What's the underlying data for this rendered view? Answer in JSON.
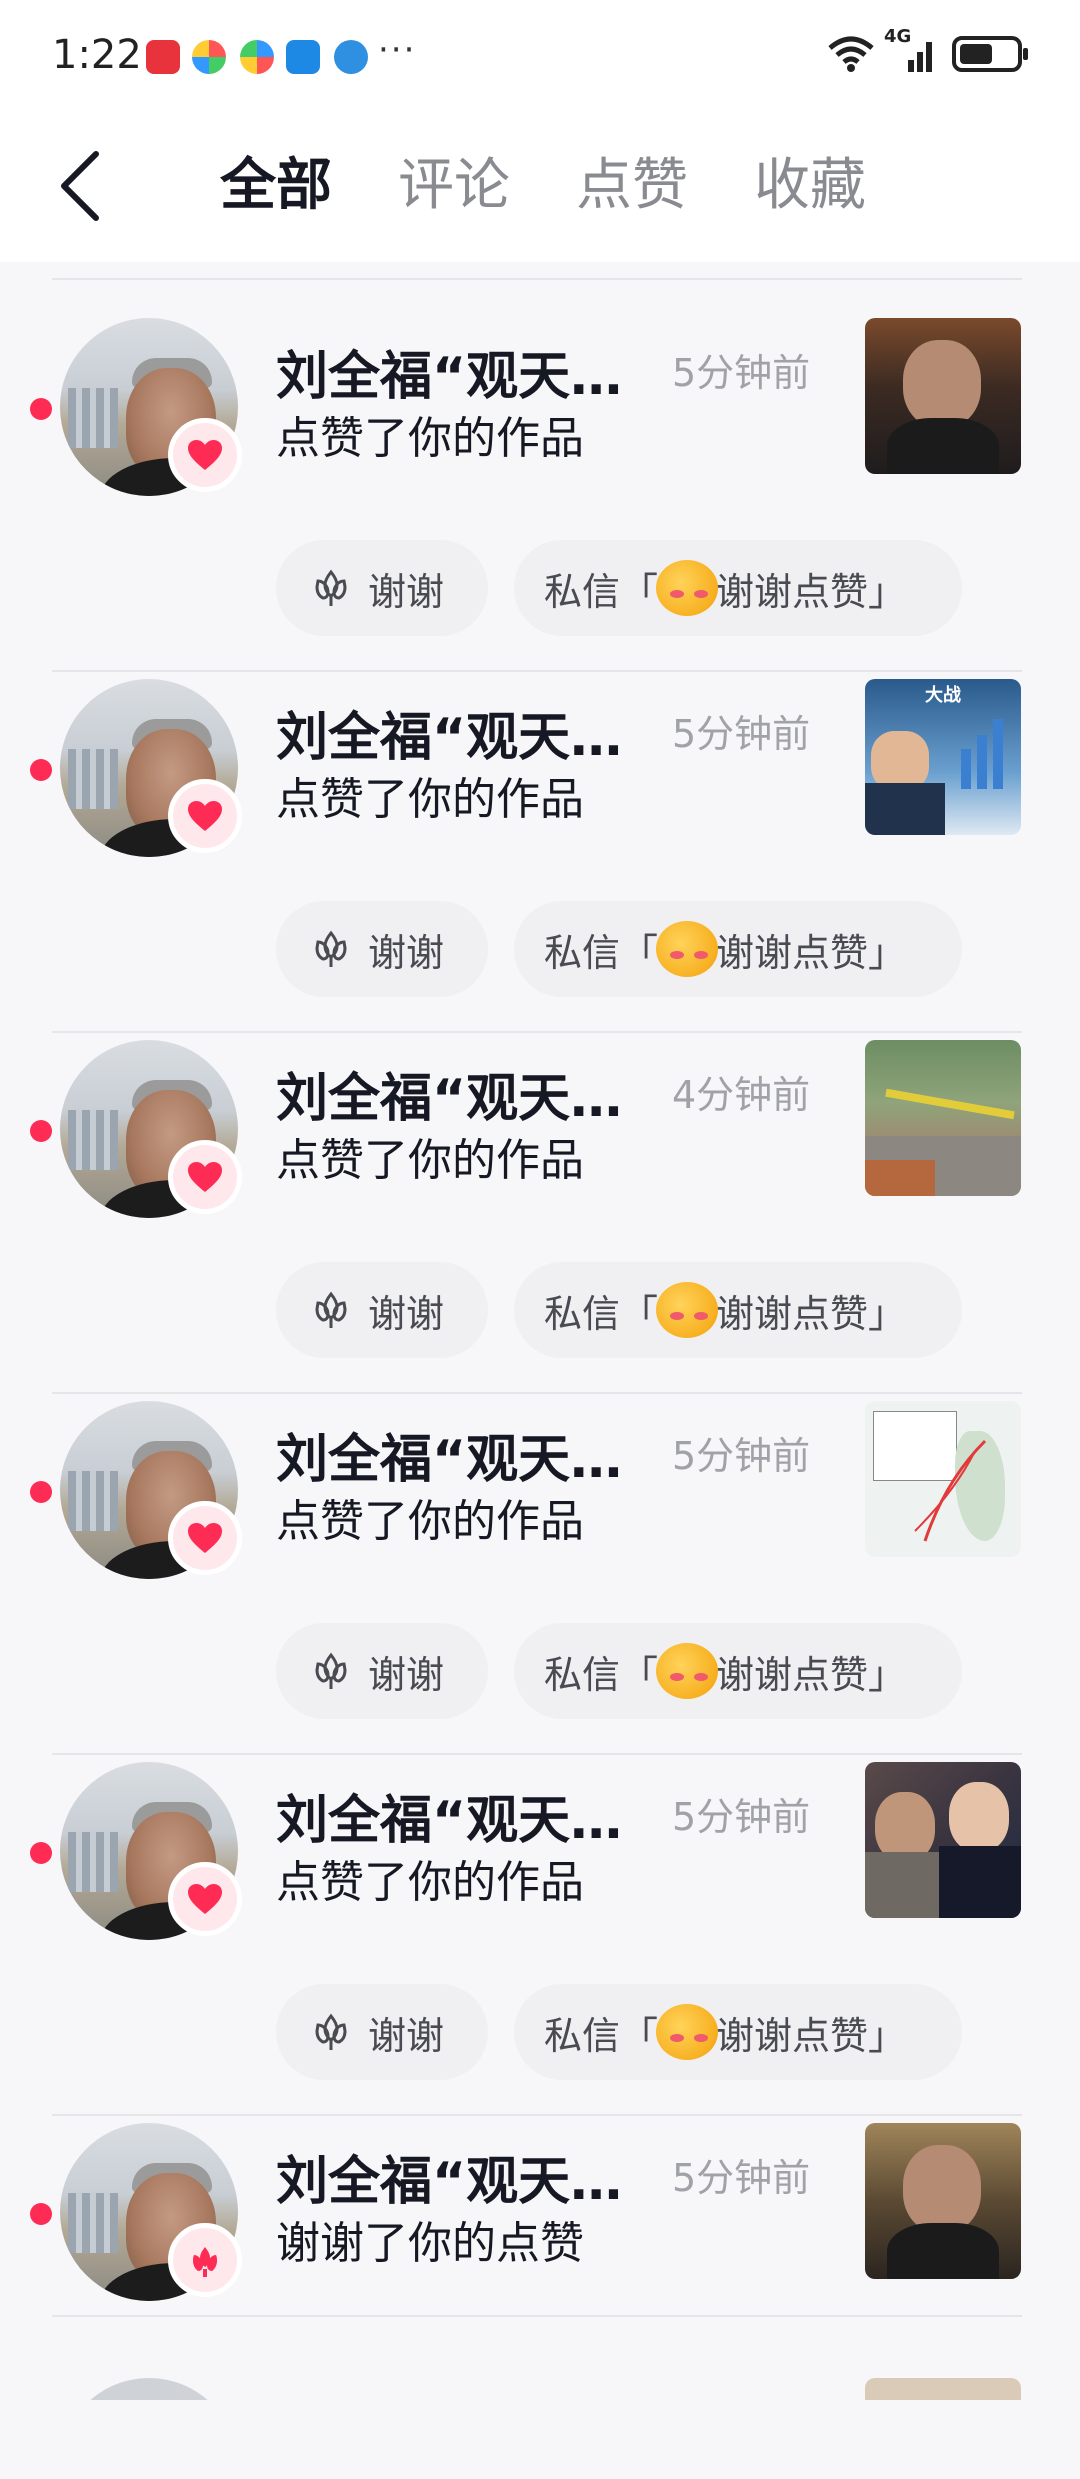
{
  "status_bar": {
    "time": "1:22",
    "more": "···",
    "network": "4G"
  },
  "header": {
    "tabs": [
      {
        "label": "全部",
        "active": true
      },
      {
        "label": "评论",
        "active": false
      },
      {
        "label": "点赞",
        "active": false
      },
      {
        "label": "收藏",
        "active": false
      }
    ]
  },
  "colors": {
    "accent": "#fe2c55",
    "text_primary": "#161823",
    "text_secondary": "#a1a2a8",
    "button_bg": "#f0f0f2"
  },
  "notifications": [
    {
      "name": "刘全福“观天…",
      "time": "5分钟前",
      "action": "点赞了你的作品",
      "badge_icon": "heart-icon",
      "thumb_caption": "",
      "thanks_label": "谢谢",
      "dm_prefix": "私信「",
      "dm_suffix": "谢谢点赞」"
    },
    {
      "name": "刘全福“观天…",
      "time": "5分钟前",
      "action": "点赞了你的作品",
      "badge_icon": "heart-icon",
      "thumb_caption": "大战",
      "thanks_label": "谢谢",
      "dm_prefix": "私信「",
      "dm_suffix": "谢谢点赞」"
    },
    {
      "name": "刘全福“观天…",
      "time": "4分钟前",
      "action": "点赞了你的作品",
      "badge_icon": "heart-icon",
      "thumb_caption": "",
      "thanks_label": "谢谢",
      "dm_prefix": "私信「",
      "dm_suffix": "谢谢点赞」"
    },
    {
      "name": "刘全福“观天…",
      "time": "5分钟前",
      "action": "点赞了你的作品",
      "badge_icon": "heart-icon",
      "thumb_caption": "",
      "thanks_label": "谢谢",
      "dm_prefix": "私信「",
      "dm_suffix": "谢谢点赞」"
    },
    {
      "name": "刘全福“观天…",
      "time": "5分钟前",
      "action": "点赞了你的作品",
      "badge_icon": "heart-icon",
      "thumb_caption": "",
      "thanks_label": "谢谢",
      "dm_prefix": "私信「",
      "dm_suffix": "谢谢点赞」"
    },
    {
      "name": "刘全福“观天…",
      "time": "5分钟前",
      "action": "谢谢了你的点赞",
      "badge_icon": "flower-icon",
      "thumb_caption": "",
      "thanks_label": "",
      "dm_prefix": "",
      "dm_suffix": ""
    }
  ]
}
